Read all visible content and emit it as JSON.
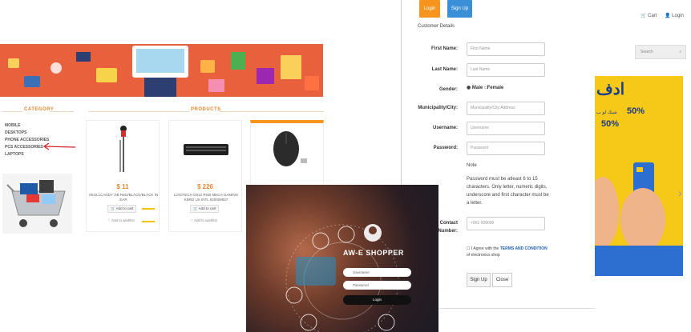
{
  "shop": {
    "category_title": "CATEGORY",
    "products_title": "PRODUCTS",
    "categories": [
      "MOBILE",
      "DESKTOPS",
      "PHONE ACCESSORIES",
      "PCS ACCESSORIES",
      "LAPTOPS"
    ],
    "products": [
      {
        "price": "$ 11",
        "name": "SKULLCANDY JIB RED/BLACK/BLACK IN EAR",
        "add_to_cart": "Add to cart",
        "wishlist": "Add to wishlist"
      },
      {
        "price": "$ 226",
        "name": "LOGITECH G512 RGB MECH GAMING KBRD US INTL 920008837",
        "add_to_cart": "Add to cart",
        "wishlist": "Add to wishlist"
      }
    ]
  },
  "header": {
    "cart": "Cart",
    "login": "Login",
    "search_placeholder": "Search"
  },
  "promo": {
    "title": "ادف",
    "line1": "50%",
    "line2": "50%",
    "line3": "شيك لو ب"
  },
  "modal": {
    "login_tab": "Login",
    "signup_tab": "Sign Up",
    "section_title": "Customer Details",
    "fields": {
      "first_name": {
        "label": "First Name:",
        "placeholder": "First Name"
      },
      "last_name": {
        "label": "Last Name:",
        "placeholder": "Last Name"
      },
      "gender": {
        "label": "Gender:",
        "male": "Male",
        "female": "Female"
      },
      "municipality": {
        "label": "Municipality/City:",
        "placeholder": "Municipality/City Address"
      },
      "username": {
        "label": "Username:",
        "placeholder": "Username"
      },
      "password": {
        "label": "Password:",
        "placeholder": "Password"
      },
      "contact": {
        "label_1": "Contact",
        "label_2": "Number:",
        "placeholder": "+961 000000"
      }
    },
    "note_title": "Note",
    "note_text": [
      "Password must be atleast 6 to 15",
      "characters. Only letter, numeric digits,",
      "underscore and first character must be",
      "a letter."
    ],
    "agree_prefix": "I Agree with the",
    "agree_link": "TERMS AND CONDITION",
    "agree_suffix": "of electronics shop",
    "signup_button": "Sign Up",
    "close_button": "Close"
  },
  "hero": {
    "title": "AW-E SHOPPER",
    "username_placeholder": "Username",
    "password_placeholder": "Password",
    "login_button": "Login"
  },
  "colors": {
    "accent_orange": "#f7941d",
    "signup_blue": "#3a8fd6",
    "banner": "#e8613c",
    "price": "#e8862e",
    "promo": "#f6c818"
  }
}
